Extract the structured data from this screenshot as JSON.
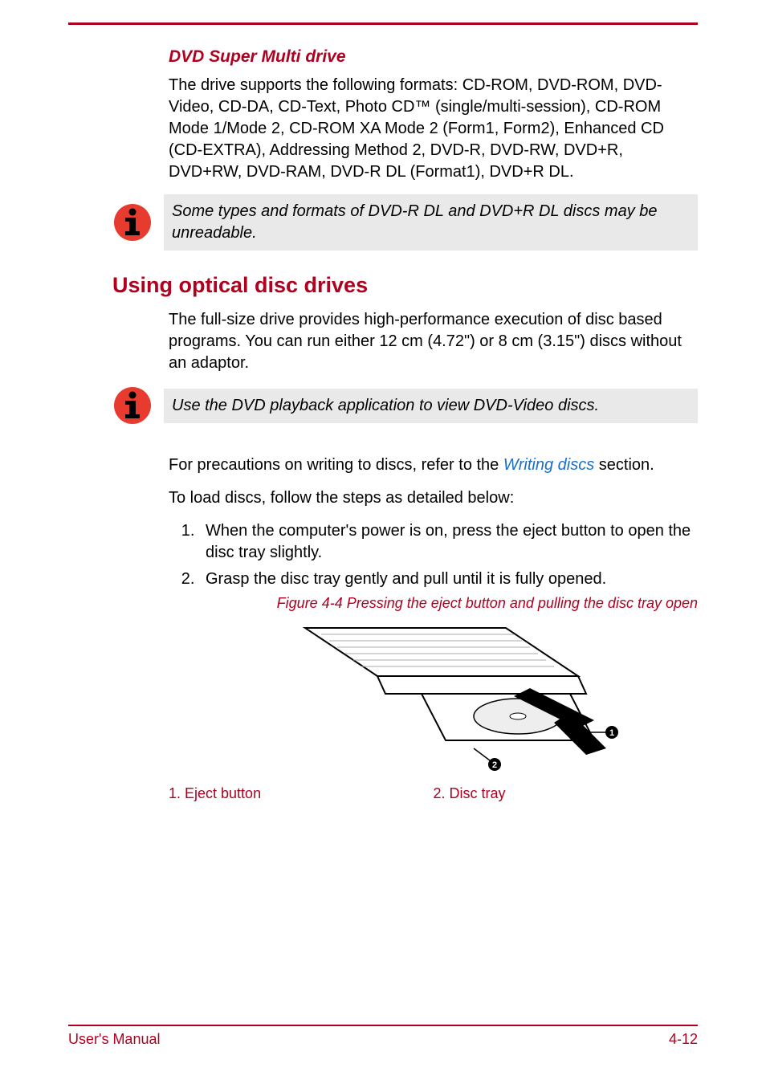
{
  "subheading": "DVD Super Multi drive",
  "para1": "The drive supports the following formats: CD-ROM, DVD-ROM, DVD-Video, CD-DA, CD-Text, Photo CD™ (single/multi-session), CD-ROM Mode 1/Mode 2, CD-ROM XA Mode 2 (Form1, Form2), Enhanced CD (CD-EXTRA), Addressing Method 2, DVD-R, DVD-RW, DVD+R, DVD+RW, DVD-RAM, DVD-R DL (Format1), DVD+R DL.",
  "note1": "Some types and formats of DVD-R DL and DVD+R DL discs may be unreadable.",
  "section_heading": "Using optical disc drives",
  "para2": "The full-size drive provides high-performance execution of disc based programs. You can run either 12 cm (4.72\") or 8 cm (3.15\") discs without an adaptor.",
  "note2": "Use the DVD playback application to view DVD-Video discs.",
  "para3_pre": "For precautions on writing to discs, refer to the ",
  "para3_link": "Writing discs",
  "para3_post": " section.",
  "para4": "To load discs, follow the steps as detailed below:",
  "steps": [
    "When the computer's power is on, press the eject button to open the disc tray slightly.",
    "Grasp the disc tray gently and pull until it is fully opened."
  ],
  "figure_caption": "Figure 4-4 Pressing the eject button and pulling the disc tray open",
  "legend": {
    "l1": "1. Eject button",
    "l2": "2. Disc tray"
  },
  "callouts": {
    "c1": "1",
    "c2": "2"
  },
  "footer": {
    "left": "User's Manual",
    "right": "4-12"
  }
}
